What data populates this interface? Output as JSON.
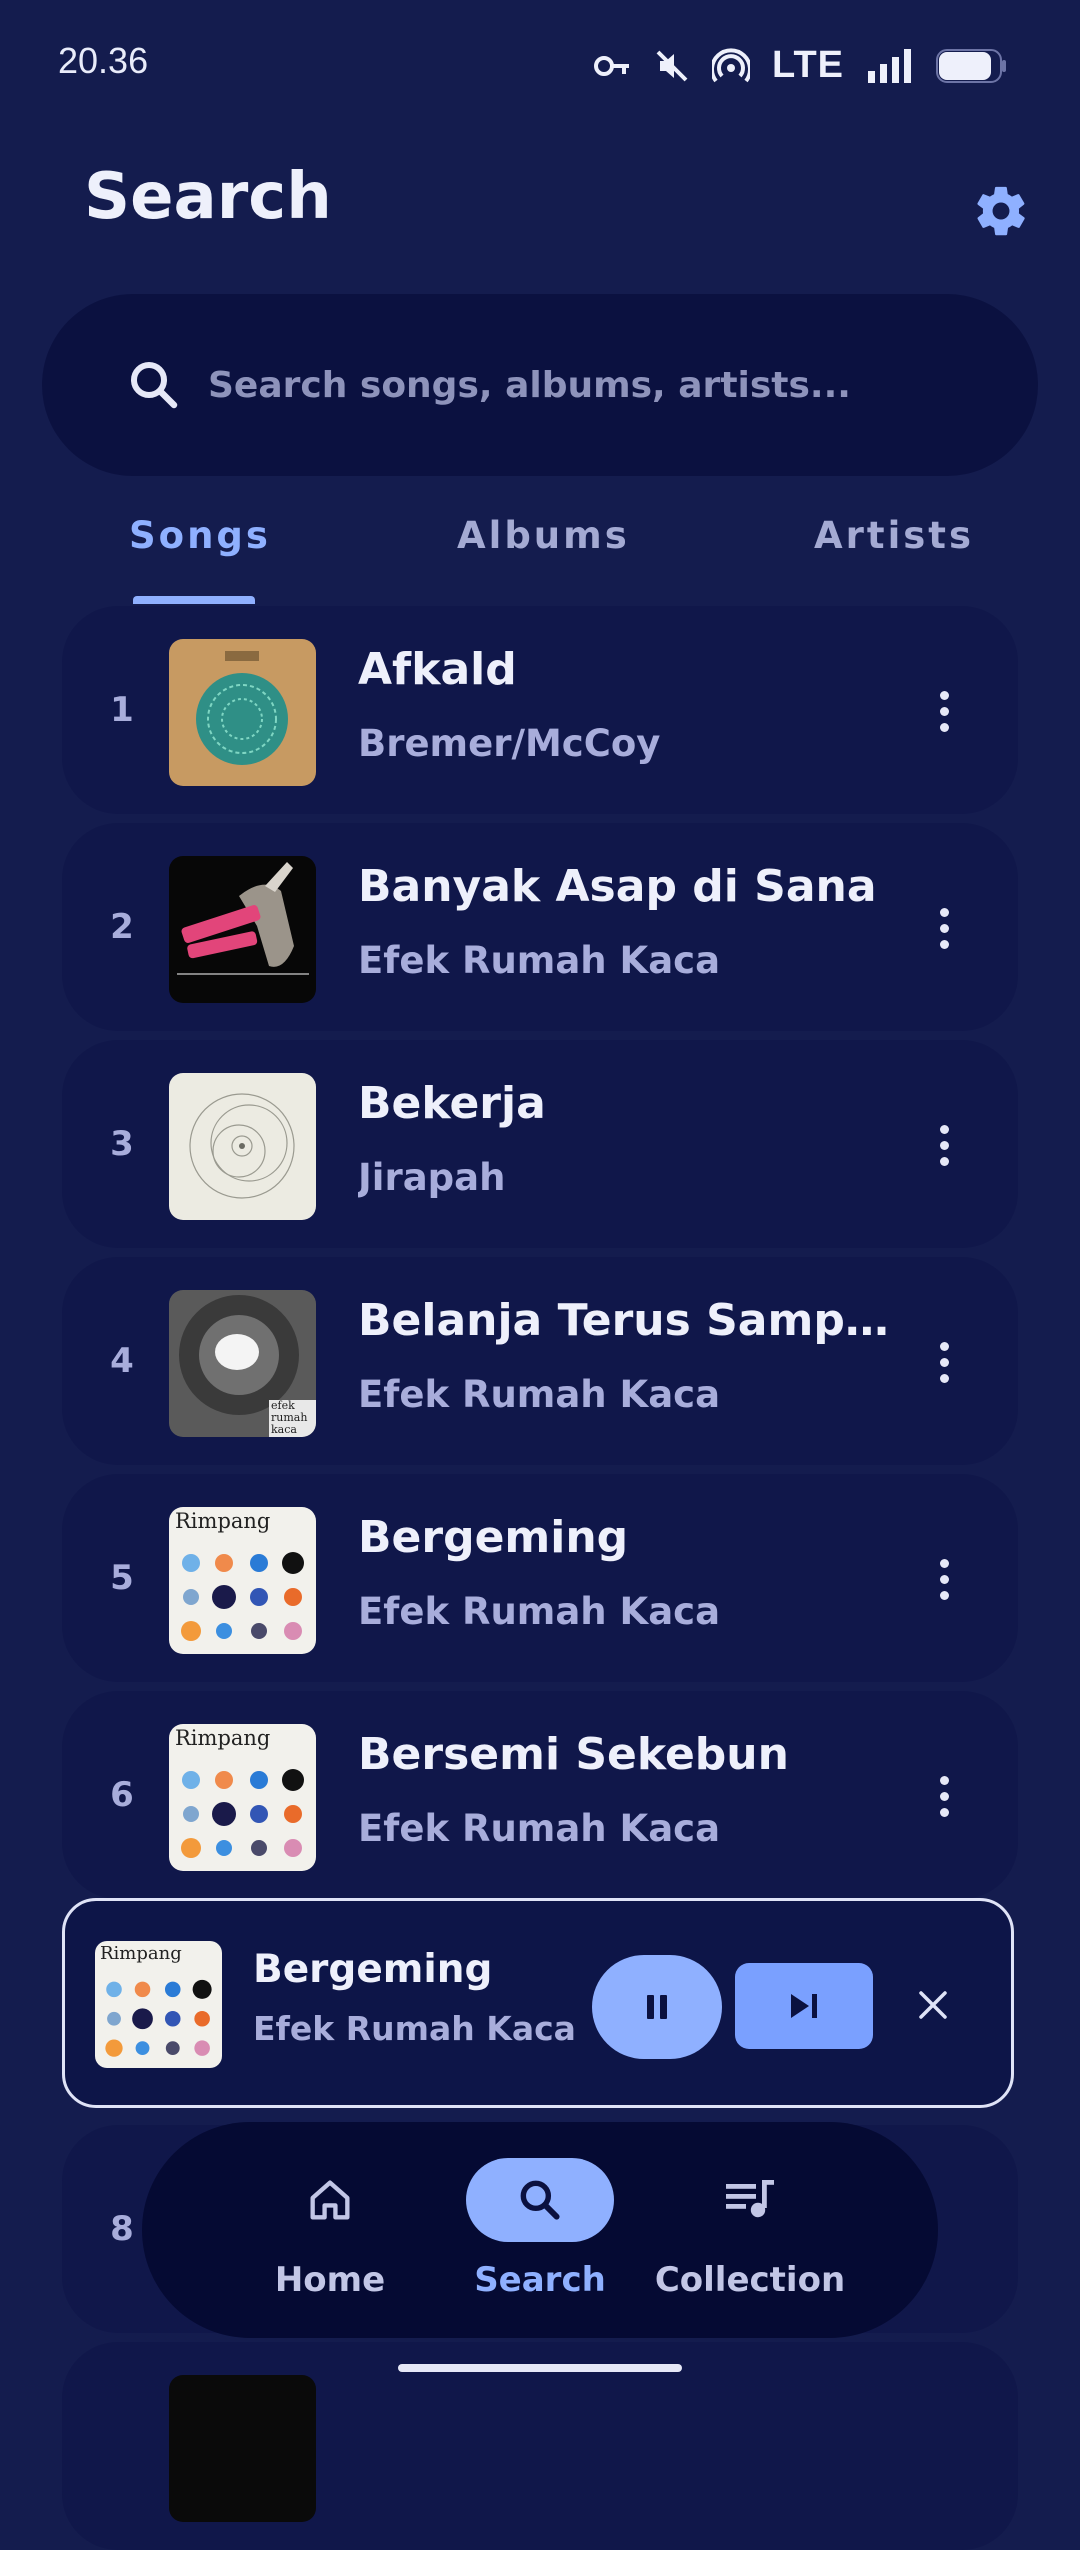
{
  "status": {
    "time": "20.36",
    "network": "LTE",
    "icons": [
      "key-icon",
      "mute-icon",
      "hotspot-icon",
      "signal-icon",
      "battery-icon"
    ]
  },
  "header": {
    "title": "Search",
    "settings_icon": "gear-icon"
  },
  "search": {
    "placeholder": "Search songs, albums, artists..."
  },
  "tabs": [
    {
      "label": "Songs",
      "active": true
    },
    {
      "label": "Albums",
      "active": false
    },
    {
      "label": "Artists",
      "active": false
    }
  ],
  "songs": [
    {
      "index": "1",
      "title": "Afkald",
      "artist": "Bremer/McCoy",
      "cover": "afkald-cover"
    },
    {
      "index": "2",
      "title": "Banyak Asap di Sana",
      "artist": "Efek Rumah Kaca",
      "cover": "banyak-asap-cover"
    },
    {
      "index": "3",
      "title": "Bekerja",
      "artist": "Jirapah",
      "cover": "bekerja-cover"
    },
    {
      "index": "4",
      "title": "Belanja Terus Sampai Mati",
      "artist": "Efek Rumah Kaca",
      "cover": "belanja-cover"
    },
    {
      "index": "5",
      "title": "Bergeming",
      "artist": "Efek Rumah Kaca",
      "cover": "rimpang-cover"
    },
    {
      "index": "6",
      "title": "Bersemi Sekebun",
      "artist": "Efek Rumah Kaca",
      "cover": "rimpang-cover"
    },
    {
      "index": "8",
      "title": "",
      "artist": "",
      "cover": ""
    }
  ],
  "cover_text": {
    "rimpang": "Rimpang",
    "efek": "efek rumah kaca"
  },
  "now_playing": {
    "title": "Bergeming",
    "artist": "Efek Rumah Kaca",
    "state": "playing"
  },
  "nav": [
    {
      "label": "Home",
      "icon": "home-icon",
      "active": false
    },
    {
      "label": "Search",
      "icon": "search-icon",
      "active": true
    },
    {
      "label": "Collection",
      "icon": "queue-music-icon",
      "active": false
    }
  ],
  "colors": {
    "background": "#141c4e",
    "accent": "#8fb0ff",
    "card": "#10174a",
    "nav_bar": "#050a33"
  }
}
